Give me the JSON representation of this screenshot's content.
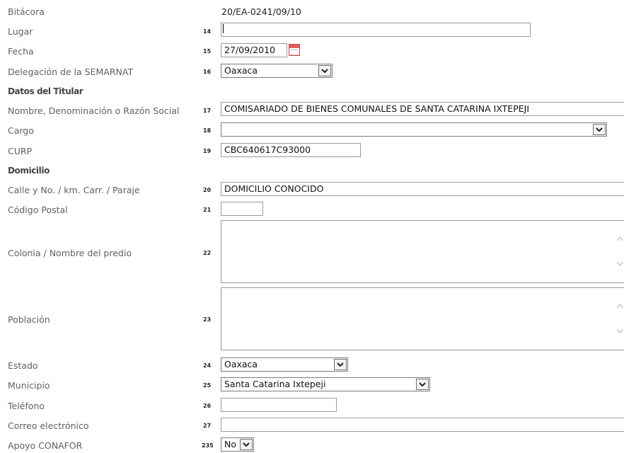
{
  "fields": {
    "bitacora": {
      "label": "Bitácora",
      "value": "20/EA-0241/09/10"
    },
    "lugar": {
      "label": "Lugar",
      "number": "14",
      "value": ""
    },
    "fecha": {
      "label": "Fecha",
      "number": "15",
      "value": "27/09/2010",
      "icon": "calendar-icon"
    },
    "delegacion": {
      "label": "Delegación de la SEMARNAT",
      "number": "16",
      "value": "Oaxaca"
    },
    "nombre": {
      "label": "Nombre, Denominación o Razón Social",
      "number": "17",
      "value": "COMISARIADO DE BIENES COMUNALES DE SANTA CATARINA IXTEPEJI"
    },
    "cargo": {
      "label": "Cargo",
      "number": "18",
      "value": ""
    },
    "curp": {
      "label": "CURP",
      "number": "19",
      "value": "CBC640617C93000"
    },
    "calle": {
      "label": "Calle y No. / km. Carr. / Paraje",
      "number": "20",
      "value": "DOMICILIO CONOCIDO"
    },
    "cp": {
      "label": "Código Postal",
      "number": "21",
      "value": ""
    },
    "colonia": {
      "label": "Colonia / Nombre del predio",
      "number": "22",
      "value": ""
    },
    "poblacion": {
      "label": "Población",
      "number": "23",
      "value": ""
    },
    "estado": {
      "label": "Estado",
      "number": "24",
      "value": "Oaxaca"
    },
    "municipio": {
      "label": "Municipio",
      "number": "25",
      "value": "Santa Catarina Ixtepeji"
    },
    "telefono": {
      "label": "Teléfono",
      "number": "26",
      "value": ""
    },
    "correo": {
      "label": "Correo electrónico",
      "number": "27",
      "value": ""
    },
    "apoyo": {
      "label": "Apoyo CONAFOR",
      "number": "235",
      "value": "No"
    }
  },
  "sections": {
    "titular": "Datos del Titular",
    "domicilio": "Domicilio"
  },
  "colors": {
    "label": "#616161",
    "border": "#9a9a9a",
    "background": "#ffffff"
  }
}
